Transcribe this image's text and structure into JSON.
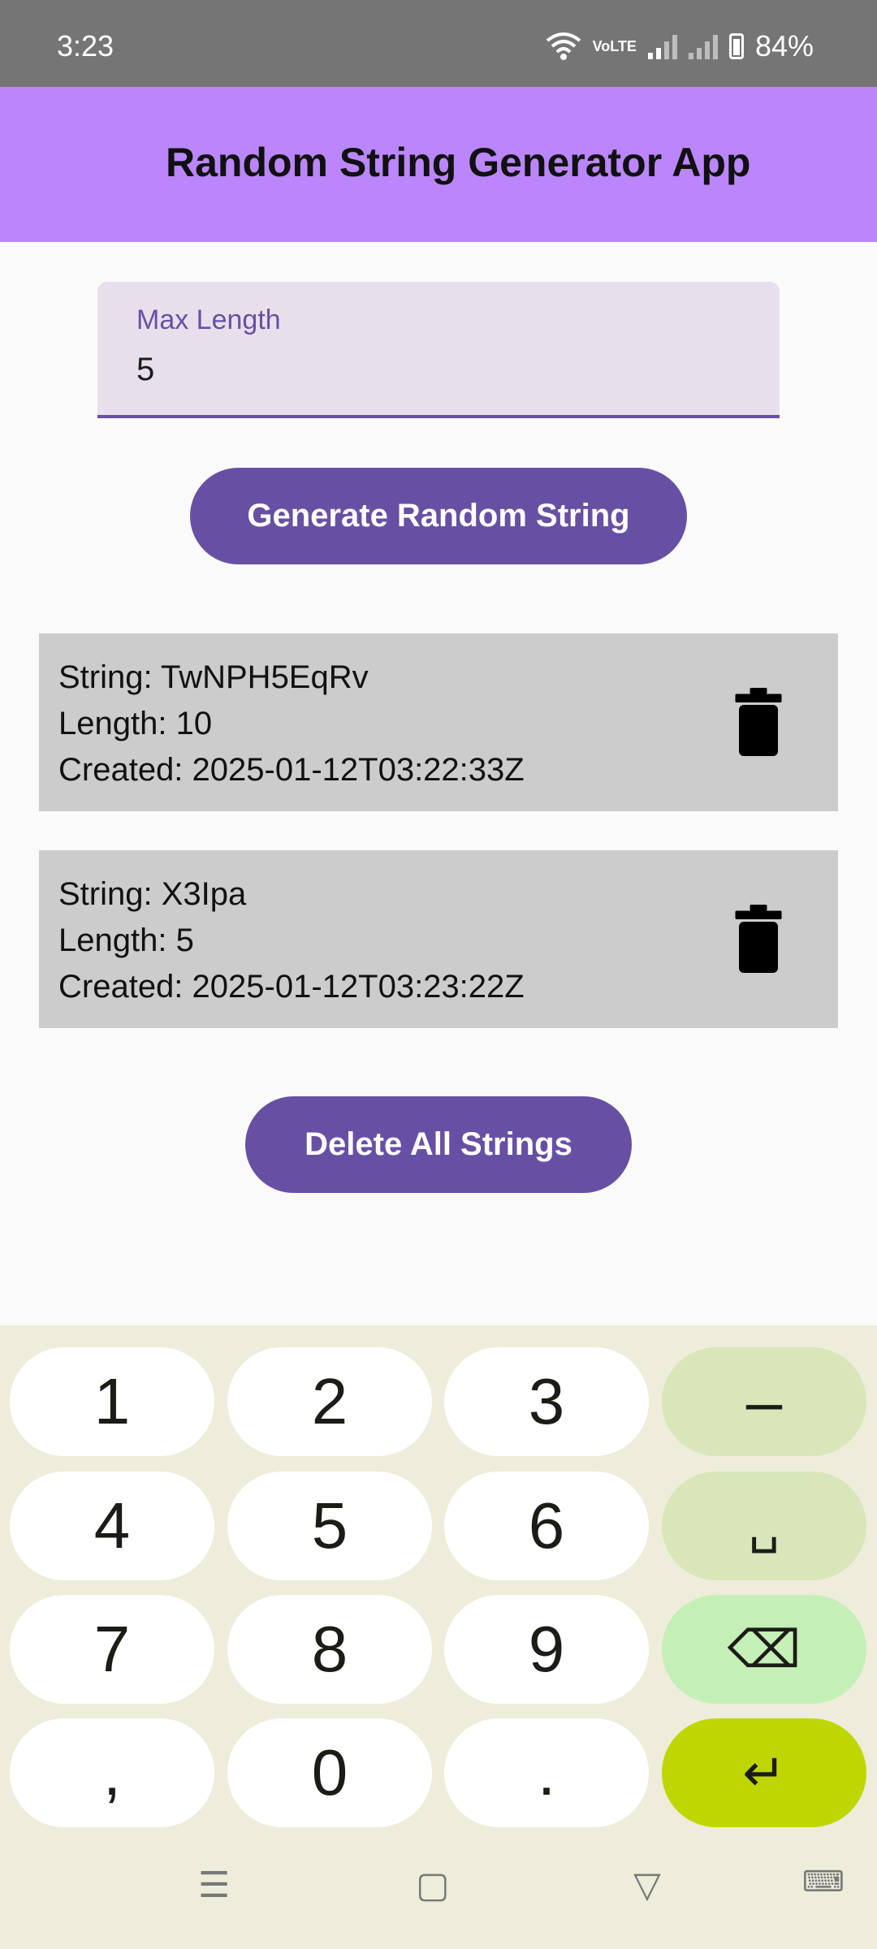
{
  "status_bar": {
    "time": "3:23",
    "battery": "84%",
    "network_label": "VoLTE"
  },
  "app_bar": {
    "title": "Random String Generator App"
  },
  "max_length_field": {
    "label": "Max Length",
    "value": "5"
  },
  "generate_button": {
    "label": "Generate Random String"
  },
  "strings": [
    {
      "string": "String: TwNPH5EqRv",
      "length": "Length: 10",
      "created": "Created: 2025-01-12T03:22:33Z"
    },
    {
      "string": "String: X3Ipa",
      "length": "Length: 5",
      "created": "Created: 2025-01-12T03:23:22Z"
    }
  ],
  "delete_all_button": {
    "label": "Delete All Strings"
  },
  "keyboard": {
    "rows": [
      [
        "1",
        "2",
        "3",
        "–"
      ],
      [
        "4",
        "5",
        "6",
        "␣"
      ],
      [
        "7",
        "8",
        "9",
        "⌫"
      ],
      [
        ",",
        "0",
        ".",
        "↵"
      ]
    ]
  },
  "colors": {
    "app_bar": "#bb86fc",
    "primary": "#6750a4",
    "card": "#cccccc",
    "status_bar": "#757575"
  }
}
